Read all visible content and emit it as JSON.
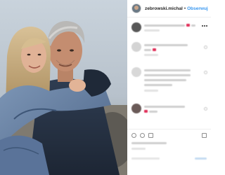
{
  "post": {
    "username": "zebrowski.michal",
    "separator": "•",
    "follow_label": "Obserwuj"
  },
  "icons": {
    "avatar": "profile-avatar",
    "more": "more-options-icon",
    "like": "heart-icon",
    "comment": "comment-icon",
    "share": "share-icon",
    "save": "bookmark-icon"
  },
  "colors": {
    "follow": "#3897f0",
    "username": "#262626",
    "accent_pink": "#e0305a"
  }
}
